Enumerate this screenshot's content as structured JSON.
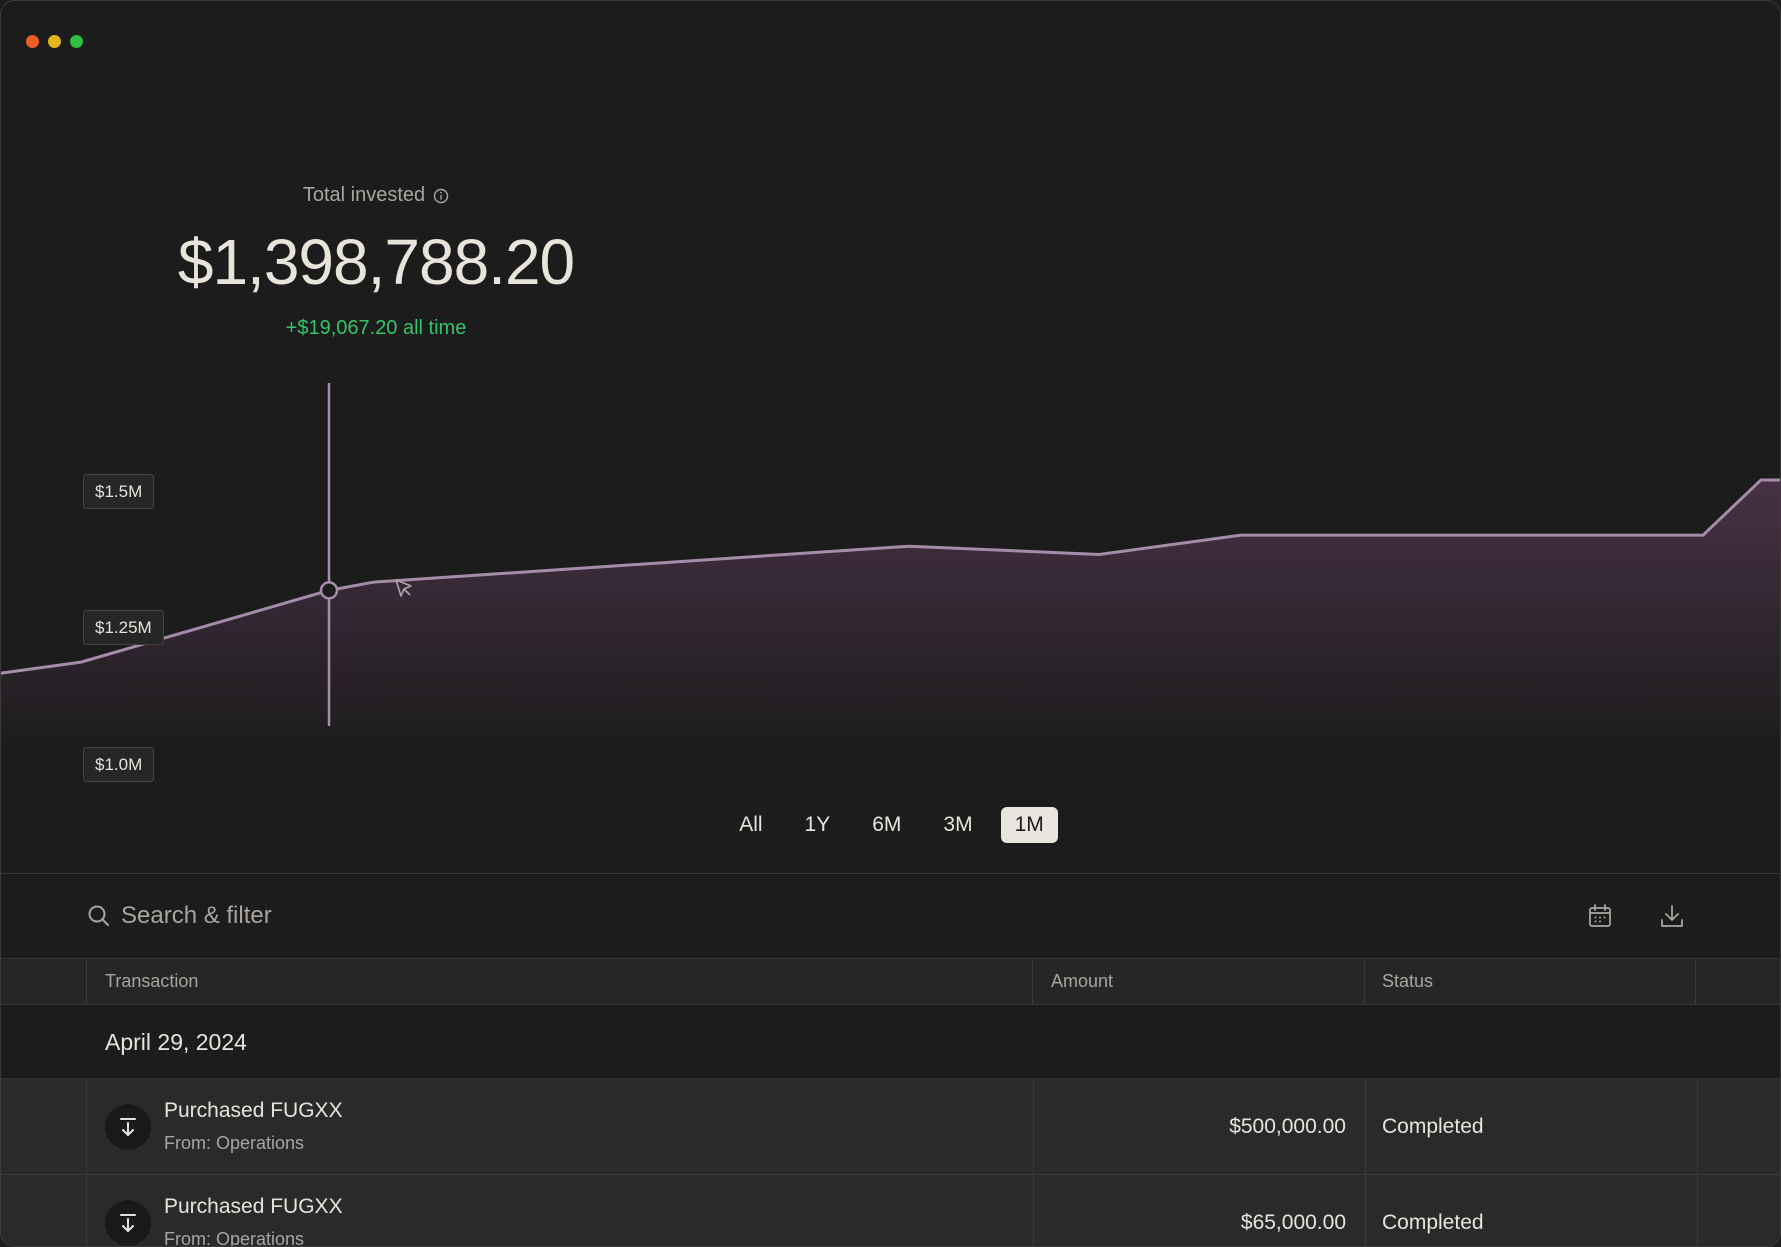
{
  "summary": {
    "label": "Total invested",
    "value": "$1,398,788.20",
    "change": "+$19,067.20 all time"
  },
  "chart_data": {
    "type": "area",
    "title": "",
    "xlabel": "",
    "ylabel": "",
    "y_tick_labels": [
      "$1.5M",
      "$1.25M",
      "$1.0M"
    ],
    "ylim": [
      1000000,
      1500000
    ],
    "series": [
      {
        "values": [
          1170000,
          1190000,
          1320000,
          1335000,
          1400000,
          1385000,
          1420000,
          1420000,
          1520000,
          1520000
        ]
      }
    ],
    "highlight_index": 2,
    "line_color": "#a58daa",
    "fill_color": "#4a3248",
    "grid": false
  },
  "ranges": {
    "options": [
      "All",
      "1Y",
      "6M",
      "3M",
      "1M"
    ],
    "selected": "1M"
  },
  "search": {
    "placeholder": "Search & filter"
  },
  "table": {
    "headers": {
      "transaction": "Transaction",
      "amount": "Amount",
      "status": "Status"
    },
    "group_date": "April 29, 2024",
    "rows": [
      {
        "title": "Purchased FUGXX",
        "subtitle": "From: Operations",
        "amount": "$500,000.00",
        "status": "Completed"
      },
      {
        "title": "Purchased FUGXX",
        "subtitle": "From: Operations",
        "amount": "$65,000.00",
        "status": "Completed"
      }
    ]
  },
  "icons": {
    "info": "info-icon",
    "cursor": "cursor-icon",
    "search": "search-icon",
    "calendar": "calendar-icon",
    "download": "download-icon",
    "transaction": "arrow-down-to-line-icon"
  },
  "colors": {
    "background": "#1c1c1c",
    "positive": "#34c46a",
    "accent_line": "#a58daa"
  }
}
